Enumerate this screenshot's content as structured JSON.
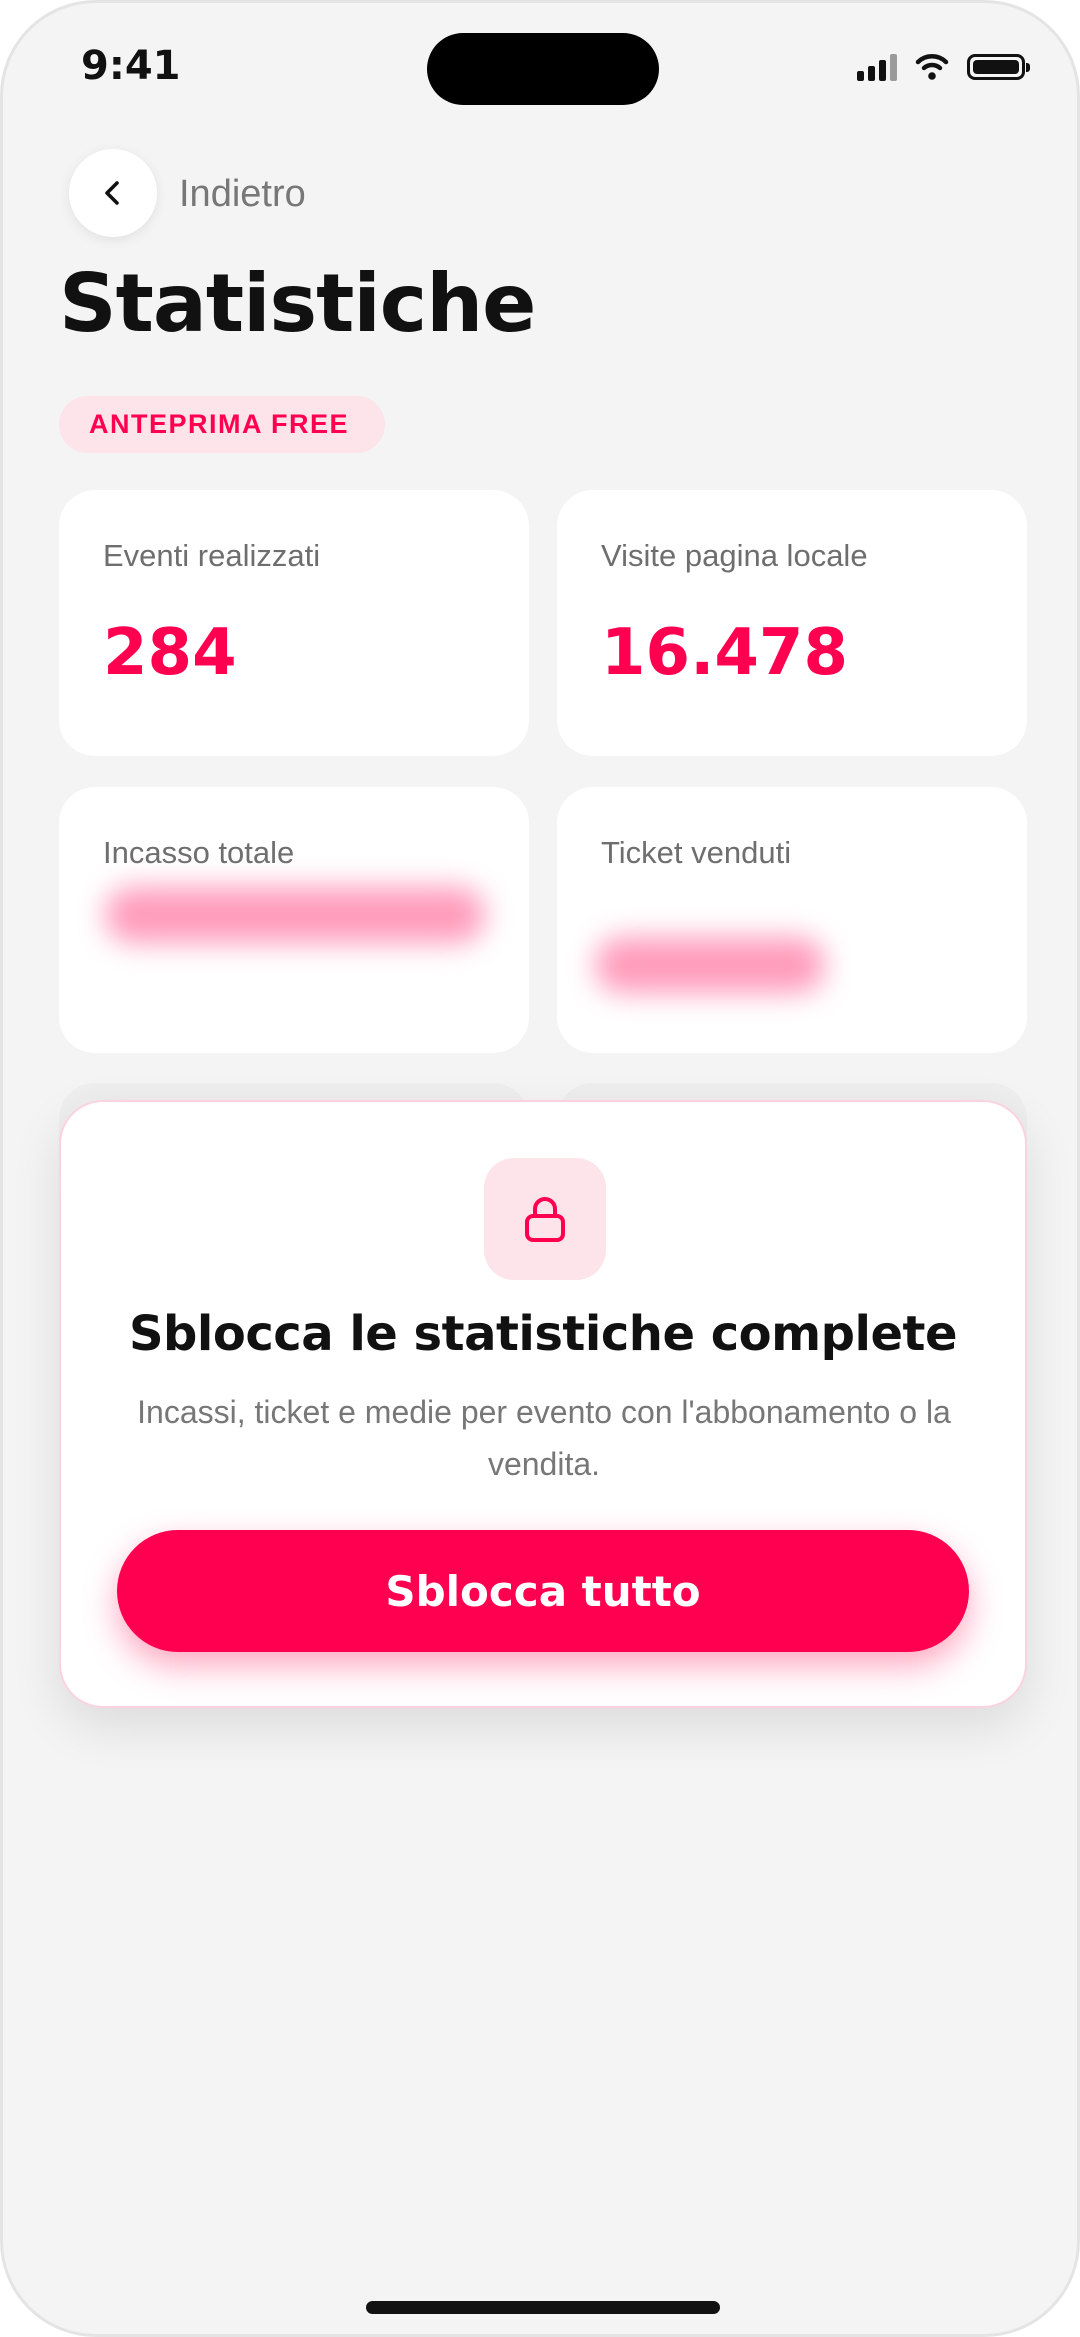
{
  "status_bar": {
    "time": "9:41"
  },
  "header": {
    "back_label": "Indietro",
    "title": "Statistiche",
    "badge": "ANTEPRIMA FREE"
  },
  "stats": [
    {
      "label": "Eventi realizzati",
      "value": "284"
    },
    {
      "label": "Visite pagina locale",
      "value": "16.478"
    },
    {
      "label": "Incasso totale"
    },
    {
      "label": "Ticket venduti"
    }
  ],
  "lock_panel": {
    "icon": "lock-icon",
    "title": "Sblocca le statistiche complete",
    "description": "Incassi, ticket e medie per evento con l'abbonamento o la vendita.",
    "cta_label": "Sblocca tutto"
  },
  "colors": {
    "accent": "#ff0050",
    "badge_bg": "#fde3ea",
    "background": "#f4f4f4"
  }
}
